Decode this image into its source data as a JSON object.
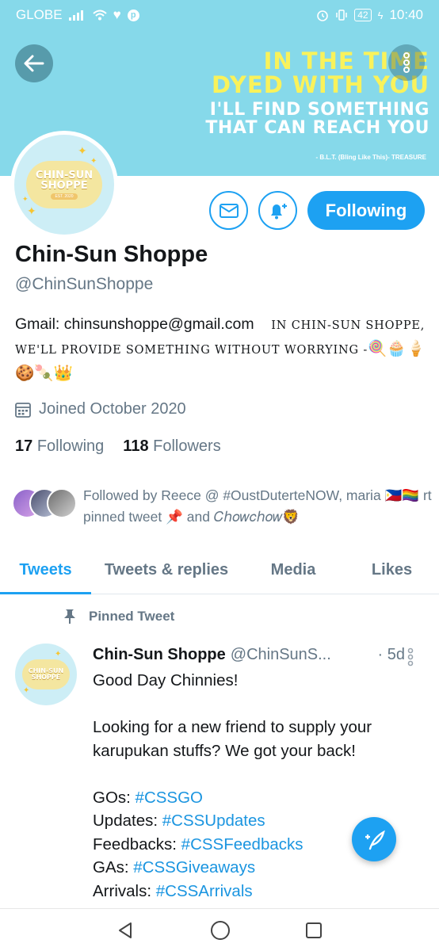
{
  "status_bar": {
    "carrier": "GLOBE",
    "battery": "42",
    "time": "10:40"
  },
  "banner": {
    "line1": "IN THE TIME",
    "line2": "DYED WITH YOU",
    "line3": "I'LL FIND SOMETHING",
    "line4": "THAT CAN REACH YOU",
    "credit": "- B.L.T. (Bling Like This)- TREASURE"
  },
  "avatar_logo": {
    "line1": "CHIN-SUN",
    "line2": "SHOPPE",
    "est": "EST. 2020"
  },
  "actions": {
    "follow_label": "Following"
  },
  "profile": {
    "name": "Chin-Sun Shoppe",
    "handle": "@ChinSunShoppe",
    "bio_prefix": "Gmail: chinsunshoppe@gmail.com",
    "bio_styled": "in chin-sun shoppe, we'll provide something without worrying -",
    "bio_emojis": "🍭🧁🍦🍪🍡👑",
    "joined": "Joined October 2020",
    "following_count": "17",
    "following_label": "Following",
    "followers_count": "118",
    "followers_label": "Followers",
    "followed_by": "Followed by Reece @ #OustDuterteNOW, maria 🇵🇭🏳️‍🌈 rt pinned tweet 📌 and 𝐶ℎ𝑜𝑤𝑐ℎ𝑜𝑤🦁"
  },
  "tabs": [
    {
      "label": "Tweets",
      "active": true
    },
    {
      "label": "Tweets & replies",
      "active": false
    },
    {
      "label": "Media",
      "active": false
    },
    {
      "label": "Likes",
      "active": false
    }
  ],
  "pinned_tweet": {
    "pinned_label": "Pinned Tweet",
    "author_name": "Chin-Sun Shoppe",
    "author_handle": "@ChinSunS...",
    "time": "· 5d",
    "greeting": "Good Day Chinnies!",
    "paragraph": "Looking for a new friend to supply your karupukan stuffs? We got your back!",
    "lines": [
      {
        "label": "GOs: ",
        "tag": "#CSSGO"
      },
      {
        "label": "Updates: ",
        "tag": "#CSSUpdates"
      },
      {
        "label": "Feedbacks: ",
        "tag": "#CSSFeedbacks"
      },
      {
        "label": "GAs: ",
        "tag": "#CSSGiveaways"
      },
      {
        "label": "Arrivals: ",
        "tag": "#CSSArrivals"
      }
    ]
  },
  "colors": {
    "accent": "#1da1f2",
    "banner": "#86d9ea",
    "banner_yellow": "#f9f25b",
    "muted": "#657786"
  }
}
